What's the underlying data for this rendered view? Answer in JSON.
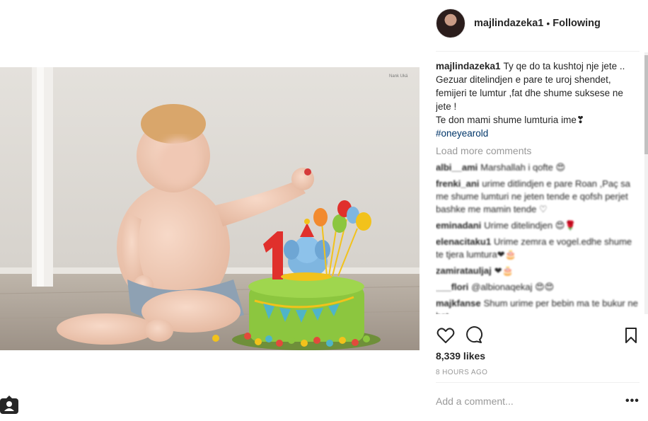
{
  "post": {
    "username": "majlindazeka1",
    "follow_status": "Following",
    "watermark": "Nank Ukä"
  },
  "caption": {
    "username": "majlindazeka1",
    "lines": [
      "Ty qe do ta kushtoj nje jete .. Gezuar ditelindjen e pare te uroj shendet, femijeri te lumtur ,fat dhe shume suksese ne jete !",
      "Te don mami shume lumturia ime❣"
    ],
    "hashtag": "#oneyearold"
  },
  "load_more": "Load more comments",
  "comments": [
    {
      "user": "albi__ami",
      "text": "Marshallah i qofte 😍"
    },
    {
      "user": "frenki_ani",
      "text": "urime ditlindjen e pare Roan ,Paç sa me shume lumturi ne jeten tende e qofsh perjet bashke me mamin tende ♡"
    },
    {
      "user": "eminadani",
      "text": "Urime ditelindjen 😍🌹"
    },
    {
      "user": "elenacitaku1",
      "text": "Urime zemra e vogel.edhe shume te tjera lumtura❤🎂"
    },
    {
      "user": "zamiratauljaj",
      "text": "❤🎂"
    },
    {
      "user": "___flori",
      "text": "@albionaqekaj 😍😍"
    },
    {
      "user": "majkfanse",
      "text": "Shum urime per bebin ma te bukur ne bot."
    }
  ],
  "actions": {
    "like_icon": "heart-icon",
    "comment_icon": "comment-icon",
    "save_icon": "bookmark-icon"
  },
  "likes": "8,339 likes",
  "time": "8 HOURS AGO",
  "add_comment_placeholder": "Add a comment...",
  "more_label": "•••",
  "colors": {
    "link": "#003569",
    "muted": "#999999",
    "text": "#262626"
  }
}
